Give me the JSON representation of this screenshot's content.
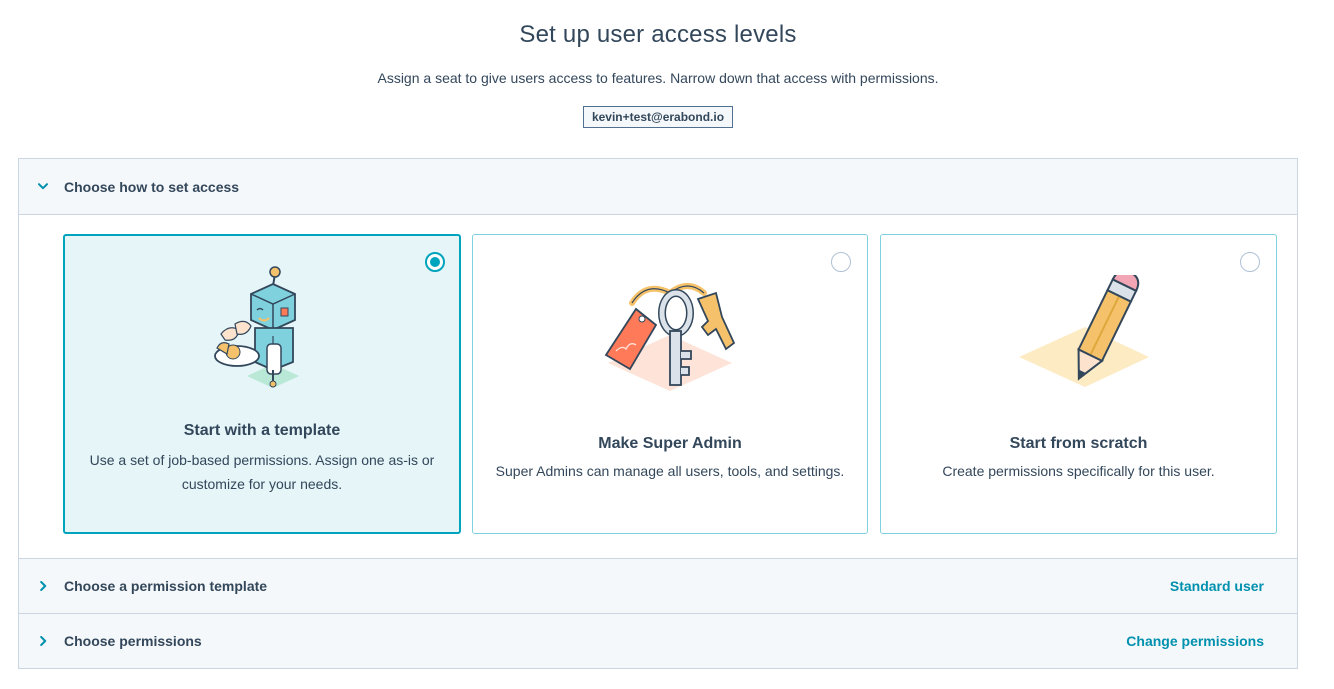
{
  "page": {
    "title": "Set up user access levels",
    "subtitle": "Assign a seat to give users access to features. Narrow down that access with permissions.",
    "email": "kevin+test@erabond.io"
  },
  "sections": {
    "access": {
      "title": "Choose how to set access",
      "expanded": true
    },
    "template": {
      "title": "Choose a permission template",
      "link": "Standard user",
      "expanded": false
    },
    "permissions": {
      "title": "Choose permissions",
      "link": "Change permissions",
      "expanded": false
    }
  },
  "cards": [
    {
      "title": "Start with a template",
      "description": "Use a set of job-based permissions. Assign one as-is or customize for your needs.",
      "selected": true,
      "illustration": "robot-waiter-illustration"
    },
    {
      "title": "Make Super Admin",
      "description": "Super Admins can manage all users, tools, and settings.",
      "selected": false,
      "illustration": "keys-illustration"
    },
    {
      "title": "Start from scratch",
      "description": "Create permissions specifically for this user.",
      "selected": false,
      "illustration": "pencil-illustration"
    }
  ],
  "colors": {
    "accent": "#00a4bd",
    "link": "#0091ae",
    "text": "#33475b",
    "header_bg": "#f5f8fa",
    "selected_bg": "#e5f5f8"
  }
}
